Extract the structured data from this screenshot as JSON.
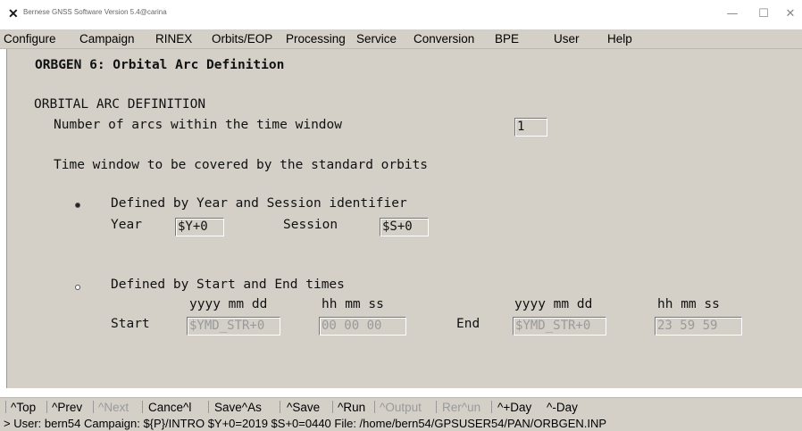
{
  "window": {
    "title": "Bernese GNSS Software Version 5.4@carina",
    "minimize_glyph": "—",
    "maximize_glyph": "☐",
    "close_glyph": "✕"
  },
  "menu": [
    "Configure",
    "Campaign",
    "RINEX",
    "Orbits/EOP",
    "Processing",
    "Service",
    "Conversion",
    "BPE",
    "User",
    "Help"
  ],
  "panel": {
    "header": "ORBGEN 6: Orbital Arc Definition",
    "section_title": "ORBITAL ARC DEFINITION",
    "num_arcs_label": "Number of arcs within the time window",
    "num_arcs_value": "1",
    "time_window_label": "Time window to be covered by the standard orbits",
    "option1": {
      "label": "Defined by Year and Session identifier",
      "selected": true,
      "year_label": "Year",
      "year_value": "$Y+0",
      "session_label": "Session",
      "session_value": "$S+0"
    },
    "option2": {
      "label": "Defined by Start and End times",
      "selected": false,
      "date_header": "yyyy mm dd",
      "time_header": "hh mm ss",
      "start_label": "Start",
      "start_date": "$YMD_STR+0",
      "start_time": "00 00 00",
      "end_label": "End",
      "end_date": "$YMD_STR+0",
      "end_time": "23 59 59"
    }
  },
  "toolbar": [
    {
      "label": "^Top",
      "enabled": true
    },
    {
      "label": "^Prev",
      "enabled": true
    },
    {
      "label": "^Next",
      "enabled": false
    },
    {
      "label": "Cance^l",
      "enabled": true
    },
    {
      "label": "Save^As",
      "enabled": true
    },
    {
      "label": "^Save",
      "enabled": true
    },
    {
      "label": "^Run",
      "enabled": true
    },
    {
      "label": "^Output",
      "enabled": false
    },
    {
      "label": "Rer^un",
      "enabled": false
    },
    {
      "label": "^+Day",
      "enabled": true
    },
    {
      "label": "^-Day",
      "enabled": true
    }
  ],
  "status": "> User: bern54  Campaign: ${P}/INTRO  $Y+0=2019  $S+0=0440  File: /home/bern54/GPSUSER54/PAN/ORBGEN.INP"
}
